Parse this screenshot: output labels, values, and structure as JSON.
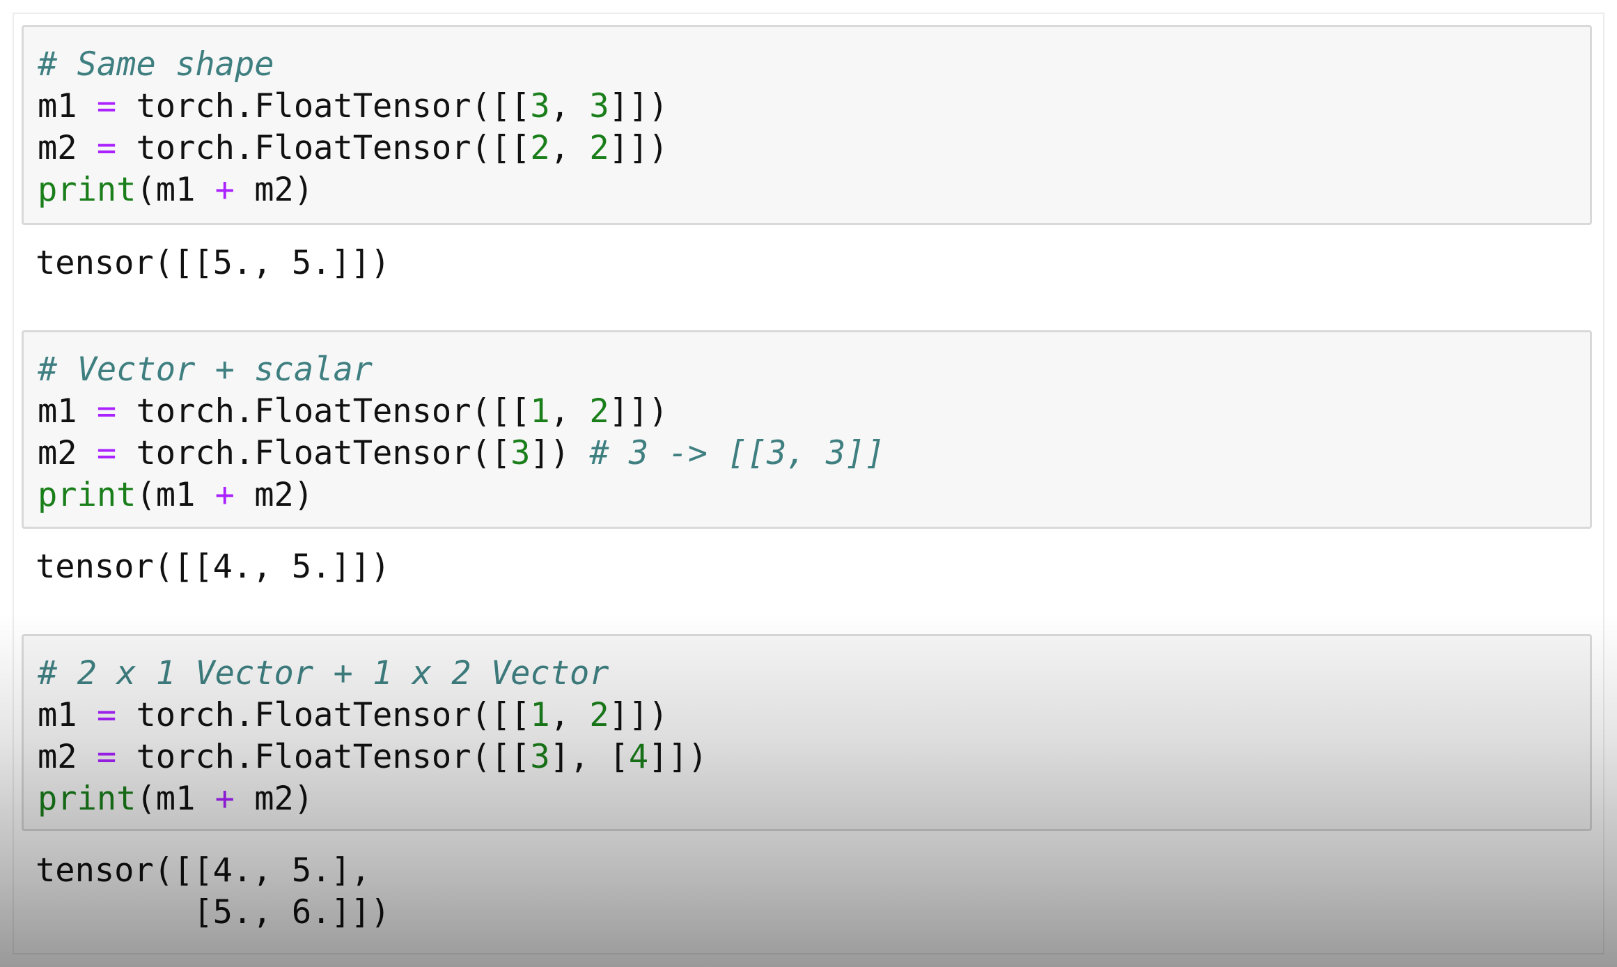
{
  "cells": [
    {
      "comment": "# Same shape",
      "lines": [
        {
          "var": "m1",
          "eq": "=",
          "pre": " torch.FloatTensor([[",
          "a": "3",
          "sep": ", ",
          "b": "3",
          "post": "]])"
        },
        {
          "var": "m2",
          "eq": "=",
          "pre": " torch.FloatTensor([[",
          "a": "2",
          "sep": ", ",
          "b": "2",
          "post": "]])"
        }
      ],
      "print": {
        "fn": "print",
        "open": "(m1 ",
        "plus": "+",
        "close": " m2)"
      },
      "output": "tensor([[5., 5.]])"
    },
    {
      "comment": "# Vector + scalar",
      "lines": [
        {
          "var": "m1",
          "eq": "=",
          "pre": " torch.FloatTensor([[",
          "a": "1",
          "sep": ", ",
          "b": "2",
          "post": "]])"
        },
        {
          "var": "m2",
          "eq": "=",
          "pre": " torch.FloatTensor([",
          "a": "3",
          "post": "]) ",
          "trailing_comment": "# 3 -> [[3, 3]]"
        }
      ],
      "print": {
        "fn": "print",
        "open": "(m1 ",
        "plus": "+",
        "close": " m2)"
      },
      "output": "tensor([[4., 5.]])"
    },
    {
      "comment": "# 2 x 1 Vector + 1 x 2 Vector",
      "lines": [
        {
          "var": "m1",
          "eq": "=",
          "pre": " torch.FloatTensor([[",
          "a": "1",
          "sep": ", ",
          "b": "2",
          "post": "]])"
        },
        {
          "var": "m2",
          "eq": "=",
          "pre": " torch.FloatTensor([[",
          "a": "3",
          "mid": "], [",
          "b": "4",
          "post": "]])"
        }
      ],
      "print": {
        "fn": "print",
        "open": "(m1 ",
        "plus": "+",
        "close": " m2)"
      },
      "output_lines": [
        "tensor([[4., 5.],",
        "        [5., 6.]])"
      ]
    }
  ],
  "colors": {
    "comment": "#3f7f80",
    "operator": "#aa22ff",
    "number": "#1a7f1a",
    "builtin": "#1a7f1a",
    "text": "#111111",
    "cell_background": "#f7f7f8",
    "cell_border": "#d9d9d9"
  }
}
